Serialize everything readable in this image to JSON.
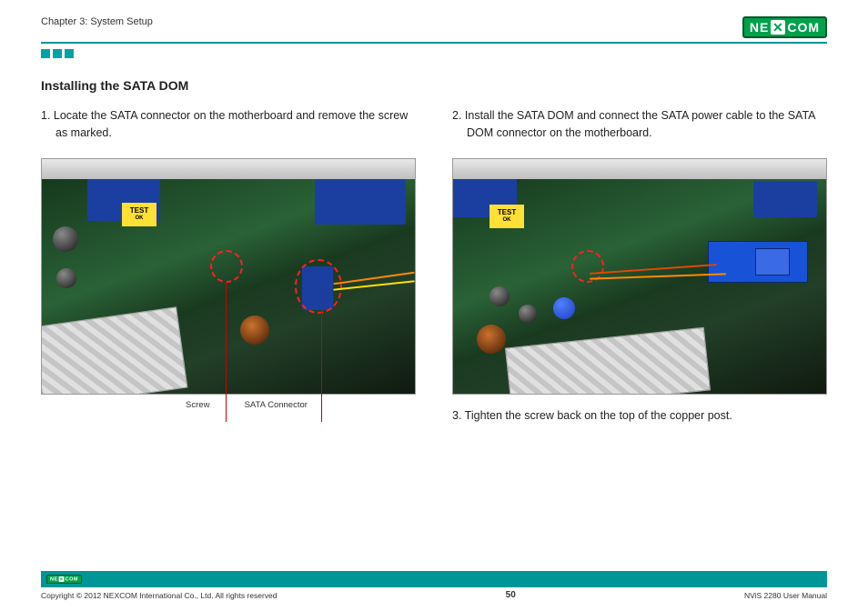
{
  "header": {
    "chapter": "Chapter 3: System Setup",
    "brand_left": "NE",
    "brand_right": "COM"
  },
  "section": {
    "title": "Installing the SATA DOM"
  },
  "left": {
    "step1": "1. Locate the SATA connector on the motherboard and remove the screw as marked.",
    "callout_screw": "Screw",
    "callout_sata": "SATA Connector"
  },
  "right": {
    "step2": "2. Install the SATA DOM and connect the SATA power cable to the SATA DOM connector on the motherboard.",
    "step3": "3. Tighten the screw back on the top of the copper post."
  },
  "sticker": {
    "line1": "TEST",
    "line2": "OK"
  },
  "footer": {
    "copyright": "Copyright © 2012 NEXCOM International Co., Ltd. All rights reserved",
    "page": "50",
    "doc": "NViS 2280 User Manual"
  }
}
